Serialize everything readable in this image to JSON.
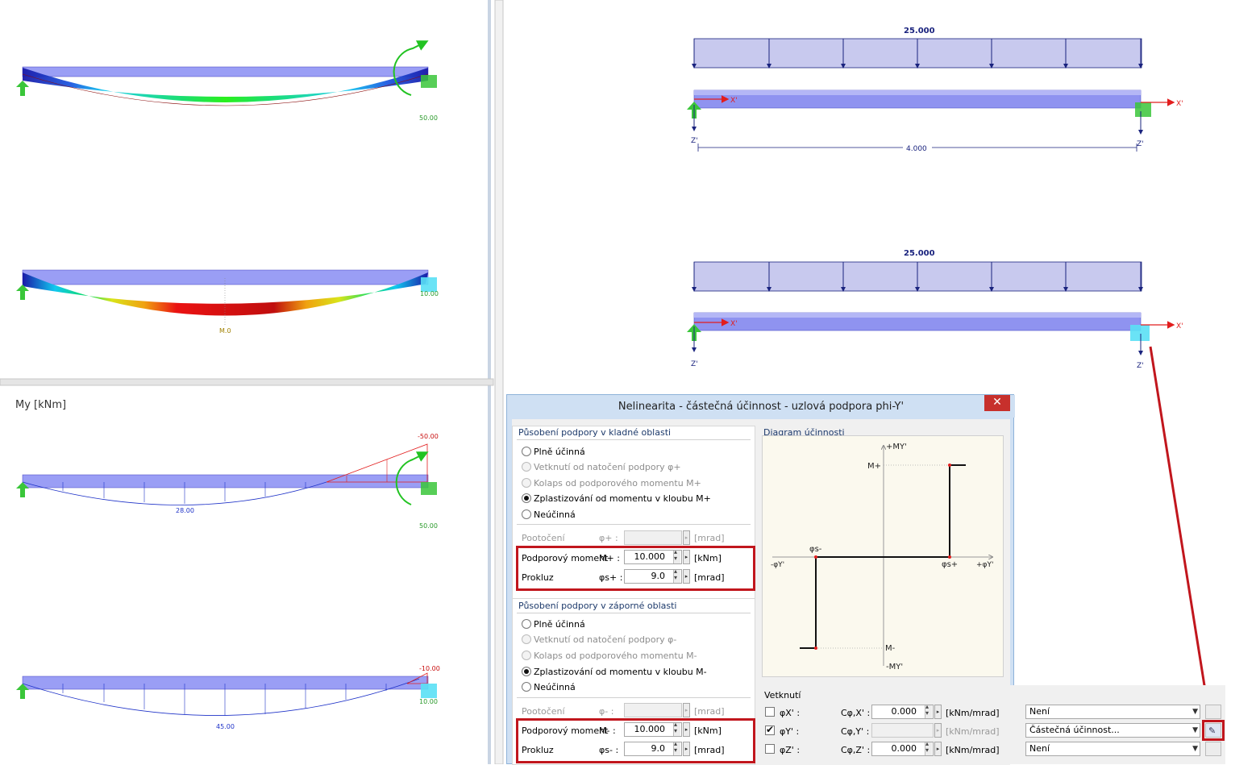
{
  "left_panel": {
    "top_result_1": {
      "value_right": "50.00"
    },
    "top_result_2": {
      "value_center": "M.0",
      "value_right": "10.00"
    },
    "moment_title": "My [kNm]",
    "moment_result_1": {
      "value_right_top": "-50.00",
      "value_center": "28.00",
      "value_right_bottom": "50.00"
    },
    "moment_result_2": {
      "value_right_top": "-10.00",
      "value_center": "45.00",
      "value_right_bottom": "10.00"
    }
  },
  "model_top": {
    "load_value": "25.000",
    "axis_x": "X'",
    "axis_z": "Z'",
    "length": "4.000"
  },
  "model_bottom": {
    "load_value": "25.000",
    "axis_x": "X'",
    "axis_z": "Z'"
  },
  "dialog": {
    "title": "Nelinearita - částečná účinnost - uzlová podpora phi-Y'",
    "close_label": "✕",
    "positive": {
      "group_title": "Působení podpory v kladné oblasti",
      "options": [
        {
          "label": "Plně účinná",
          "selected": false,
          "disabled": false
        },
        {
          "label": "Vetknutí od natočení podpory φ+",
          "selected": false,
          "disabled": true
        },
        {
          "label": "Kolaps od podporového momentu M+",
          "selected": false,
          "disabled": true
        },
        {
          "label": "Zplastizování od momentu v kloubu M+",
          "selected": true,
          "disabled": false
        },
        {
          "label": "Neúčinná",
          "selected": false,
          "disabled": false
        }
      ],
      "rotation_label": "Pootočení",
      "rotation_symbol": "φ+ :",
      "rotation_value": "",
      "rotation_unit": "[mrad]",
      "moment_label": "Podporový moment",
      "moment_symbol": "M+ :",
      "moment_value": "10.000",
      "moment_unit": "[kNm]",
      "slip_label": "Prokluz",
      "slip_symbol": "φs+ :",
      "slip_value": "9.0",
      "slip_unit": "[mrad]"
    },
    "negative": {
      "group_title": "Působení podpory v záporné oblasti",
      "options": [
        {
          "label": "Plně účinná",
          "selected": false,
          "disabled": false
        },
        {
          "label": "Vetknutí od natočení podpory φ-",
          "selected": false,
          "disabled": true
        },
        {
          "label": "Kolaps od podporového momentu M-",
          "selected": false,
          "disabled": true
        },
        {
          "label": "Zplastizování od momentu v kloubu M-",
          "selected": true,
          "disabled": false
        },
        {
          "label": "Neúčinná",
          "selected": false,
          "disabled": false
        }
      ],
      "rotation_label": "Pootočení",
      "rotation_symbol": "φ- :",
      "rotation_value": "",
      "rotation_unit": "[mrad]",
      "moment_label": "Podporový moment",
      "moment_symbol": "M- :",
      "moment_value": "10.000",
      "moment_unit": "[kNm]",
      "slip_label": "Prokluz",
      "slip_symbol": "φs- :",
      "slip_value": "9.0",
      "slip_unit": "[mrad]"
    },
    "diagram": {
      "title": "Diagram účinnosti",
      "label_my_pos": "+MY'",
      "label_my_neg": "-MY'",
      "label_m_plus": "M+",
      "label_m_minus": "M-",
      "label_phi_s_minus": "φs-",
      "label_phi_s_plus": "φs+",
      "label_phi_y_pos": "+φY'",
      "label_phi_y_neg": "-φY'"
    }
  },
  "vetknuti": {
    "title": "Vetknutí",
    "rows": [
      {
        "checked": false,
        "label": "φX' :",
        "coef": "Cφ,X' :",
        "value": "0.000",
        "unit": "[kNm/mrad]",
        "select": "Není",
        "enabled": true
      },
      {
        "checked": true,
        "label": "φY' :",
        "coef": "Cφ,Y' :",
        "value": "",
        "unit": "[kNm/mrad]",
        "select": "Částečná účinnost...",
        "enabled": false
      },
      {
        "checked": false,
        "label": "φZ' :",
        "coef": "Cφ,Z' :",
        "value": "0.000",
        "unit": "[kNm/mrad]",
        "select": "Není",
        "enabled": true
      }
    ]
  },
  "colors": {
    "accent_red": "#c1161d",
    "beam_blue": "#8a8ff0",
    "support_green": "#3ac63a"
  }
}
